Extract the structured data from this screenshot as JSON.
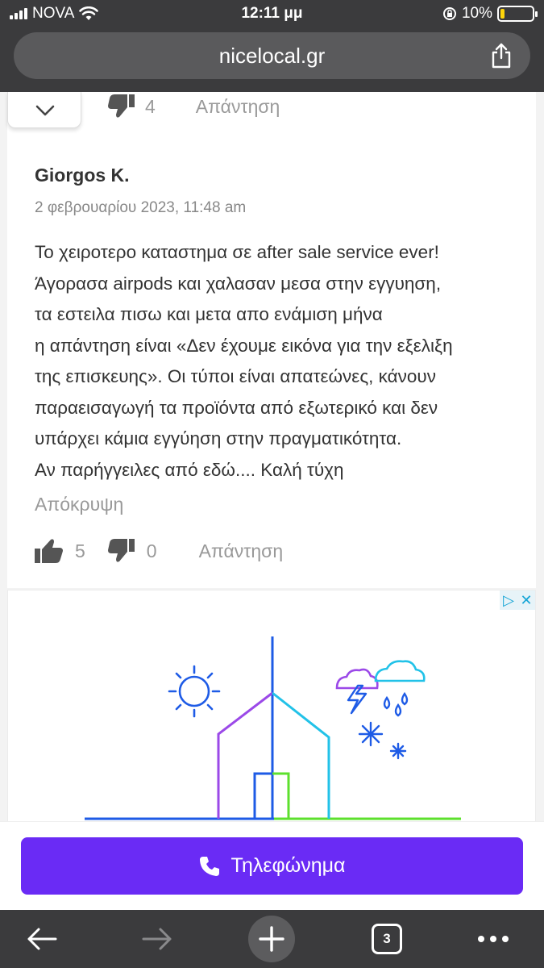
{
  "status_bar": {
    "carrier": "NOVA",
    "time": "12:11 μμ",
    "battery": "10%"
  },
  "browser": {
    "url": "nicelocal.gr",
    "tab_count": "3"
  },
  "previous_review": {
    "dislikes": "4",
    "reply_label": "Απάντηση"
  },
  "review": {
    "author": "Giorgos K.",
    "date": "2 φεβρουαρίου 2023, 11:48 am",
    "lines": [
      "Το χειροτερο καταστημα σε after sale service ever!",
      "Άγορασα airpods και χαλασαν μεσα στην εγγυηση,",
      "τα εστειλα πισω και μετα απο ενάμιση μήνα",
      "η απάντηση είναι «Δεν έχουμε εικόνα για την εξελιξη",
      "της επισκευης». Οι τύποι είναι απατεώνες, κάνουν",
      "παραεισαγωγή τα προϊόντα από εξωτερικό και δεν",
      "υπάρχει κάμια εγγύηση στην πραγματικότητα.",
      "Αν παρήγγειλες από εδώ.... Καλή τύχη"
    ],
    "hide_label": "Απόκρυψη",
    "likes": "5",
    "dislikes": "0",
    "reply_label": "Απάντηση"
  },
  "call_button": {
    "label": "Τηλεφώνημα"
  },
  "colors": {
    "accent": "#6a2bf5",
    "chrome": "#3b3b3d",
    "muted": "#999999"
  }
}
